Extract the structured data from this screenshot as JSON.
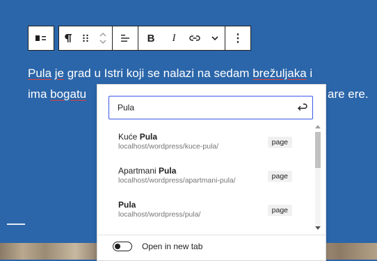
{
  "toolbar": {
    "block_type": "paragraph",
    "icons": [
      "align-left-icon",
      "paragraph-icon",
      "drag-handle-icon",
      "move-updown-icon",
      "text-align-icon",
      "bold-icon",
      "italic-icon",
      "link-icon",
      "chevron-down-icon",
      "more-options-icon"
    ],
    "bold_label": "B",
    "italic_label": "I",
    "more_label": "⋮"
  },
  "paragraph": {
    "line1_a": "Pula",
    "line1_b": " ",
    "line1_c": "je",
    "line1_d": " grad u Istri koji se nalazi na sedam ",
    "line1_e": "brežuljaka",
    "line1_f": " i",
    "line2_a": "ima ",
    "line2_b": "bogatu",
    "line2_end": "are ere."
  },
  "link_popover": {
    "search_value": "Pula",
    "results": [
      {
        "title_prefix": "Kuće ",
        "title_match": "Pula",
        "url": "localhost/wordpress/kuce-pula/",
        "type": "page"
      },
      {
        "title_prefix": "Apartmani ",
        "title_match": "Pula",
        "url": "localhost/wordpress/apartmani-pula/",
        "type": "page"
      },
      {
        "title_prefix": "",
        "title_match": "Pula",
        "url": "localhost/wordpress/pula/",
        "type": "page"
      }
    ],
    "new_tab_label": "Open in new tab",
    "new_tab_checked": false
  },
  "colors": {
    "background": "#2b66aa",
    "accent": "#3858e9",
    "text": "#1e1e1e"
  }
}
